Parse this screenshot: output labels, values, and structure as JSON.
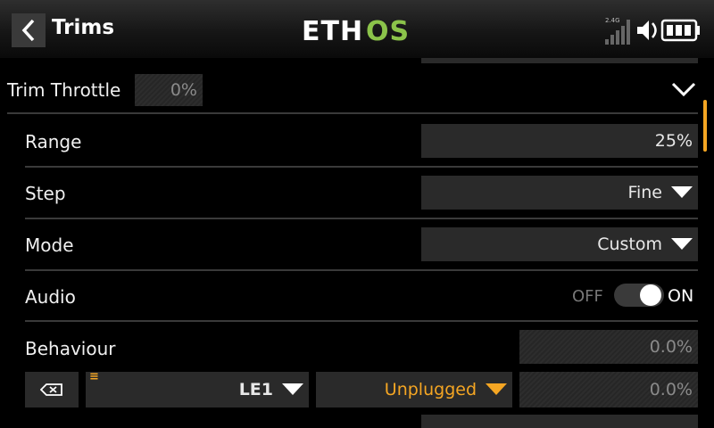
{
  "header": {
    "title": "Trims",
    "logo": "ETHOS",
    "signal_label": "2.4G",
    "icons": [
      "back-icon",
      "signal-icon",
      "speaker-icon",
      "battery-icon"
    ]
  },
  "trim": {
    "label": "Trim Throttle",
    "value": "0%"
  },
  "rows": {
    "range": {
      "label": "Range",
      "value": "25%"
    },
    "step": {
      "label": "Step",
      "value": "Fine"
    },
    "mode": {
      "label": "Mode",
      "value": "Custom"
    },
    "audio": {
      "label": "Audio",
      "off_label": "OFF",
      "on_label": "ON",
      "state": "on"
    },
    "behaviour": {
      "label": "Behaviour",
      "value": "0.0%"
    }
  },
  "behaviour_row": {
    "switch_value": "LE1",
    "mode_value": "Unplugged",
    "value": "0.0%"
  },
  "colors": {
    "accent": "#f5a623",
    "logo_green": "#8bc34a",
    "field_bg": "#2a2a2a"
  }
}
